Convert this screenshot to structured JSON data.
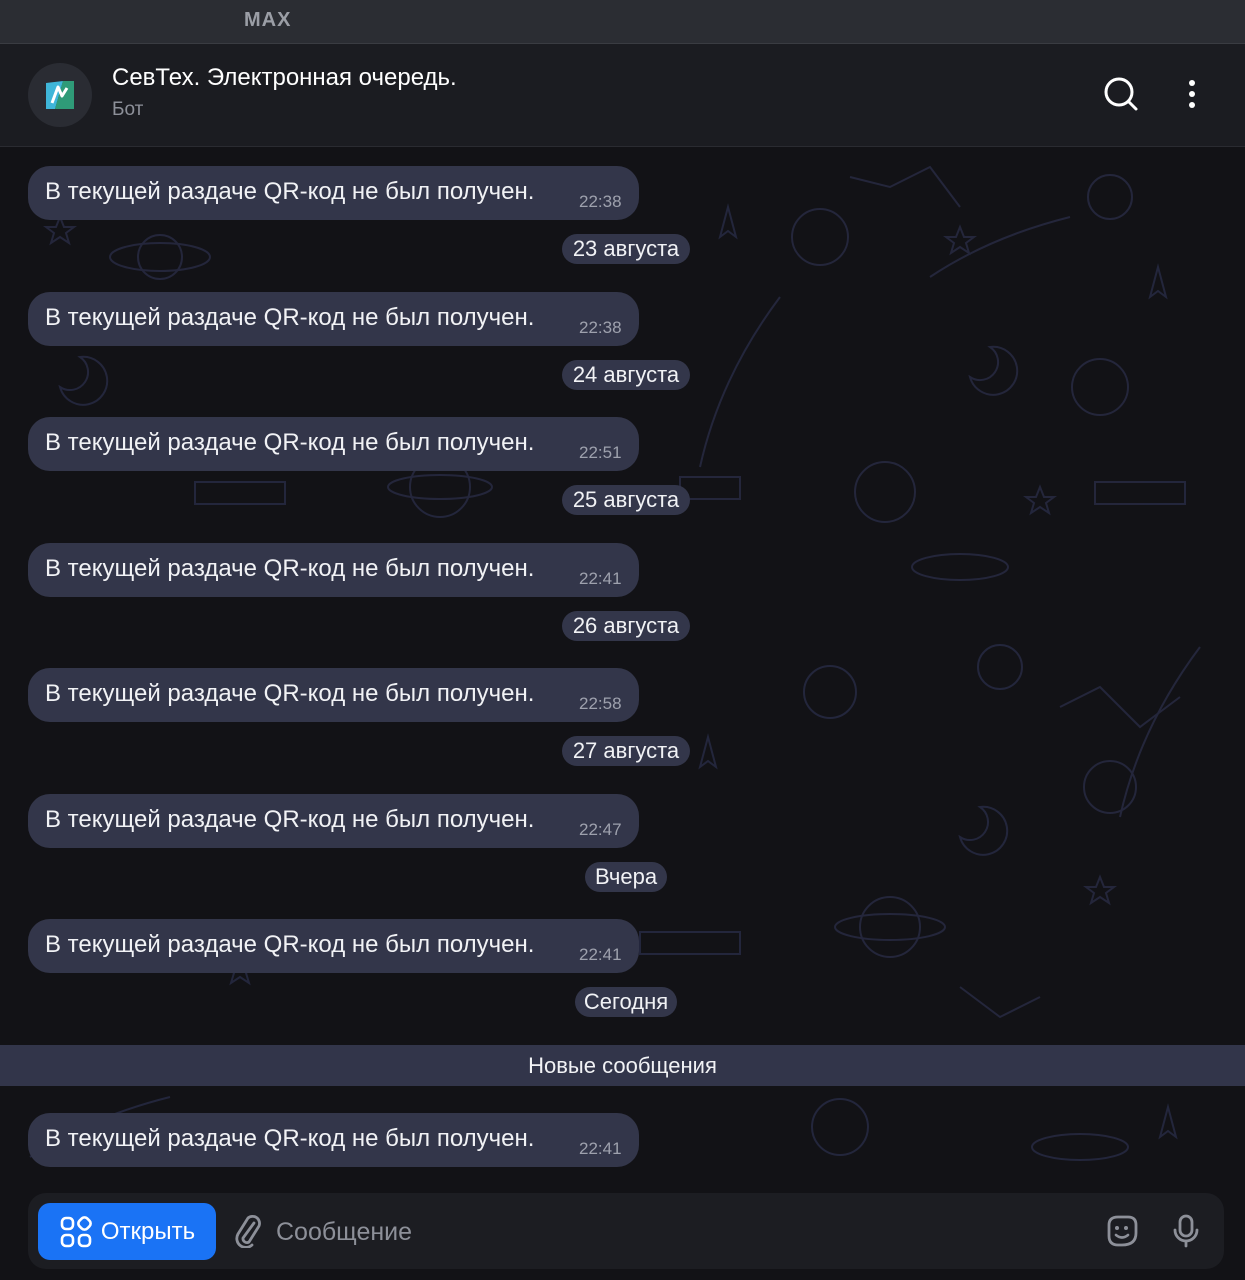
{
  "app": {
    "name": "MAX"
  },
  "chat": {
    "title": "СевТех. Электронная очередь.",
    "subtitle": "Бот"
  },
  "header_icons": {
    "search": "search-icon",
    "more": "more-vertical-icon"
  },
  "messages": [
    {
      "text": "В текущей раздаче QR-код не был получен.",
      "time": "22:38"
    },
    {
      "text": "В текущей раздаче QR-код не был получен.",
      "time": "22:38"
    },
    {
      "text": "В текущей раздаче QR-код не был получен.",
      "time": "22:51"
    },
    {
      "text": "В текущей раздаче QR-код не был получен.",
      "time": "22:41"
    },
    {
      "text": "В текущей раздаче QR-код не был получен.",
      "time": "22:58"
    },
    {
      "text": "В текущей раздаче QR-код не был получен.",
      "time": "22:47"
    },
    {
      "text": "В текущей раздаче QR-код не был получен.",
      "time": "22:41"
    },
    {
      "text": "В текущей раздаче QR-код не был получен.",
      "time": "22:41"
    }
  ],
  "date_separators": [
    "23 августа",
    "24 августа",
    "25 августа",
    "26 августа",
    "27 августа",
    "Вчера",
    "Сегодня"
  ],
  "new_messages_label": "Новые сообщения",
  "composer": {
    "open_button_label": "Открыть",
    "placeholder": "Сообщение"
  },
  "colors": {
    "accent": "#1a73f5",
    "bubble": "#33364a",
    "background": "#121216"
  }
}
